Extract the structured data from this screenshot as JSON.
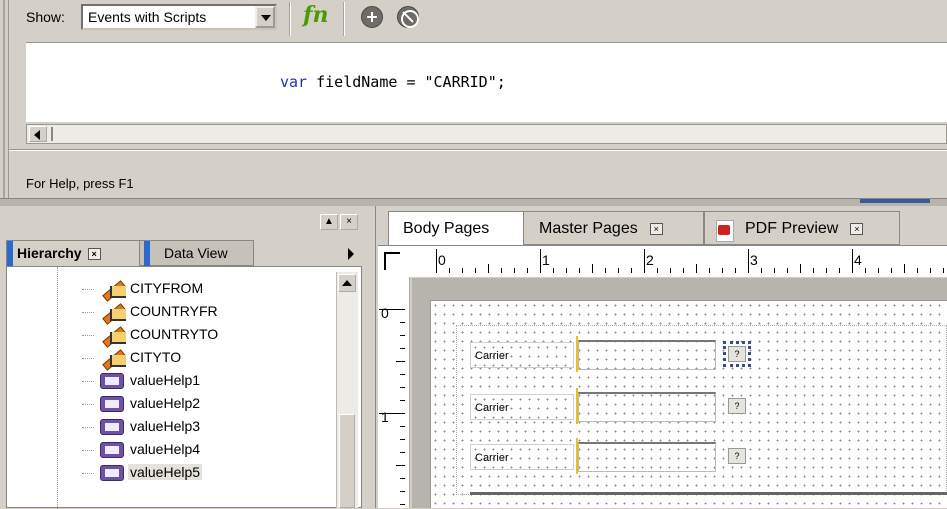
{
  "toolbar": {
    "show_label": "Show:",
    "show_value": "Events with Scripts",
    "fn_label": "fn"
  },
  "editor": {
    "code_keyword": "var",
    "code_identifier": " fieldName ",
    "code_operator": "=",
    "code_string": " \"CARRID\";"
  },
  "status": {
    "help_text": "For Help, press F1"
  },
  "hierarchy": {
    "tabs": [
      {
        "label": "Hierarchy",
        "active": true
      },
      {
        "label": "Data View",
        "active": false
      }
    ],
    "close_glyph": "×",
    "items": [
      {
        "label": "CITYFROM",
        "icon": "text-field-icon"
      },
      {
        "label": "COUNTRYFR",
        "icon": "text-field-icon"
      },
      {
        "label": "COUNTRYTO",
        "icon": "text-field-icon"
      },
      {
        "label": "CITYTO",
        "icon": "text-field-icon"
      },
      {
        "label": "valueHelp1",
        "icon": "button-object-icon"
      },
      {
        "label": "valueHelp2",
        "icon": "button-object-icon"
      },
      {
        "label": "valueHelp3",
        "icon": "button-object-icon"
      },
      {
        "label": "valueHelp4",
        "icon": "button-object-icon"
      },
      {
        "label": "valueHelp5",
        "icon": "button-object-icon",
        "selected": true
      }
    ]
  },
  "design": {
    "tabs": [
      {
        "label": "Body Pages",
        "active": true
      },
      {
        "label": "Master Pages",
        "active": false
      },
      {
        "label": "PDF Preview",
        "active": false
      }
    ],
    "ruler_h": [
      "0",
      "1",
      "2",
      "3",
      "4"
    ],
    "ruler_v": [
      "0",
      "1"
    ],
    "fields": [
      {
        "caption": "Carrier",
        "button": "?",
        "selected": true
      },
      {
        "caption": "Carrier",
        "button": "?",
        "selected": false
      },
      {
        "caption": "Carrier",
        "button": "?",
        "selected": false
      }
    ]
  },
  "colors": {
    "chrome": "#d4d0c8",
    "tab_accent": "#2a6acc",
    "keyword": "#2233aa",
    "fn_green": "#4a9a00",
    "field_marker": "#e8c020"
  }
}
